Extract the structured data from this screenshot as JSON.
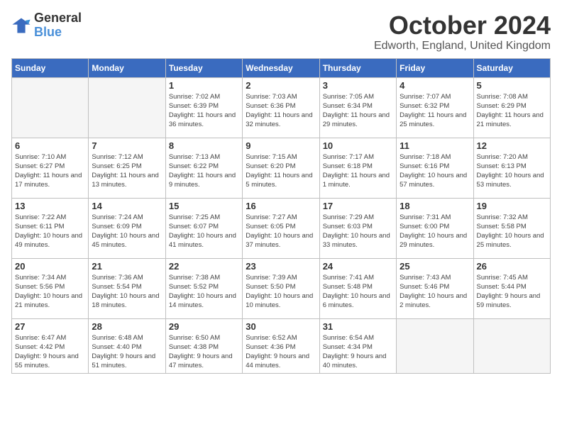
{
  "header": {
    "logo_line1": "General",
    "logo_line2": "Blue",
    "month": "October 2024",
    "location": "Edworth, England, United Kingdom"
  },
  "weekdays": [
    "Sunday",
    "Monday",
    "Tuesday",
    "Wednesday",
    "Thursday",
    "Friday",
    "Saturday"
  ],
  "weeks": [
    [
      {
        "day": "",
        "detail": ""
      },
      {
        "day": "",
        "detail": ""
      },
      {
        "day": "1",
        "detail": "Sunrise: 7:02 AM\nSunset: 6:39 PM\nDaylight: 11 hours and 36 minutes."
      },
      {
        "day": "2",
        "detail": "Sunrise: 7:03 AM\nSunset: 6:36 PM\nDaylight: 11 hours and 32 minutes."
      },
      {
        "day": "3",
        "detail": "Sunrise: 7:05 AM\nSunset: 6:34 PM\nDaylight: 11 hours and 29 minutes."
      },
      {
        "day": "4",
        "detail": "Sunrise: 7:07 AM\nSunset: 6:32 PM\nDaylight: 11 hours and 25 minutes."
      },
      {
        "day": "5",
        "detail": "Sunrise: 7:08 AM\nSunset: 6:29 PM\nDaylight: 11 hours and 21 minutes."
      }
    ],
    [
      {
        "day": "6",
        "detail": "Sunrise: 7:10 AM\nSunset: 6:27 PM\nDaylight: 11 hours and 17 minutes."
      },
      {
        "day": "7",
        "detail": "Sunrise: 7:12 AM\nSunset: 6:25 PM\nDaylight: 11 hours and 13 minutes."
      },
      {
        "day": "8",
        "detail": "Sunrise: 7:13 AM\nSunset: 6:22 PM\nDaylight: 11 hours and 9 minutes."
      },
      {
        "day": "9",
        "detail": "Sunrise: 7:15 AM\nSunset: 6:20 PM\nDaylight: 11 hours and 5 minutes."
      },
      {
        "day": "10",
        "detail": "Sunrise: 7:17 AM\nSunset: 6:18 PM\nDaylight: 11 hours and 1 minute."
      },
      {
        "day": "11",
        "detail": "Sunrise: 7:18 AM\nSunset: 6:16 PM\nDaylight: 10 hours and 57 minutes."
      },
      {
        "day": "12",
        "detail": "Sunrise: 7:20 AM\nSunset: 6:13 PM\nDaylight: 10 hours and 53 minutes."
      }
    ],
    [
      {
        "day": "13",
        "detail": "Sunrise: 7:22 AM\nSunset: 6:11 PM\nDaylight: 10 hours and 49 minutes."
      },
      {
        "day": "14",
        "detail": "Sunrise: 7:24 AM\nSunset: 6:09 PM\nDaylight: 10 hours and 45 minutes."
      },
      {
        "day": "15",
        "detail": "Sunrise: 7:25 AM\nSunset: 6:07 PM\nDaylight: 10 hours and 41 minutes."
      },
      {
        "day": "16",
        "detail": "Sunrise: 7:27 AM\nSunset: 6:05 PM\nDaylight: 10 hours and 37 minutes."
      },
      {
        "day": "17",
        "detail": "Sunrise: 7:29 AM\nSunset: 6:03 PM\nDaylight: 10 hours and 33 minutes."
      },
      {
        "day": "18",
        "detail": "Sunrise: 7:31 AM\nSunset: 6:00 PM\nDaylight: 10 hours and 29 minutes."
      },
      {
        "day": "19",
        "detail": "Sunrise: 7:32 AM\nSunset: 5:58 PM\nDaylight: 10 hours and 25 minutes."
      }
    ],
    [
      {
        "day": "20",
        "detail": "Sunrise: 7:34 AM\nSunset: 5:56 PM\nDaylight: 10 hours and 21 minutes."
      },
      {
        "day": "21",
        "detail": "Sunrise: 7:36 AM\nSunset: 5:54 PM\nDaylight: 10 hours and 18 minutes."
      },
      {
        "day": "22",
        "detail": "Sunrise: 7:38 AM\nSunset: 5:52 PM\nDaylight: 10 hours and 14 minutes."
      },
      {
        "day": "23",
        "detail": "Sunrise: 7:39 AM\nSunset: 5:50 PM\nDaylight: 10 hours and 10 minutes."
      },
      {
        "day": "24",
        "detail": "Sunrise: 7:41 AM\nSunset: 5:48 PM\nDaylight: 10 hours and 6 minutes."
      },
      {
        "day": "25",
        "detail": "Sunrise: 7:43 AM\nSunset: 5:46 PM\nDaylight: 10 hours and 2 minutes."
      },
      {
        "day": "26",
        "detail": "Sunrise: 7:45 AM\nSunset: 5:44 PM\nDaylight: 9 hours and 59 minutes."
      }
    ],
    [
      {
        "day": "27",
        "detail": "Sunrise: 6:47 AM\nSunset: 4:42 PM\nDaylight: 9 hours and 55 minutes."
      },
      {
        "day": "28",
        "detail": "Sunrise: 6:48 AM\nSunset: 4:40 PM\nDaylight: 9 hours and 51 minutes."
      },
      {
        "day": "29",
        "detail": "Sunrise: 6:50 AM\nSunset: 4:38 PM\nDaylight: 9 hours and 47 minutes."
      },
      {
        "day": "30",
        "detail": "Sunrise: 6:52 AM\nSunset: 4:36 PM\nDaylight: 9 hours and 44 minutes."
      },
      {
        "day": "31",
        "detail": "Sunrise: 6:54 AM\nSunset: 4:34 PM\nDaylight: 9 hours and 40 minutes."
      },
      {
        "day": "",
        "detail": ""
      },
      {
        "day": "",
        "detail": ""
      }
    ]
  ]
}
